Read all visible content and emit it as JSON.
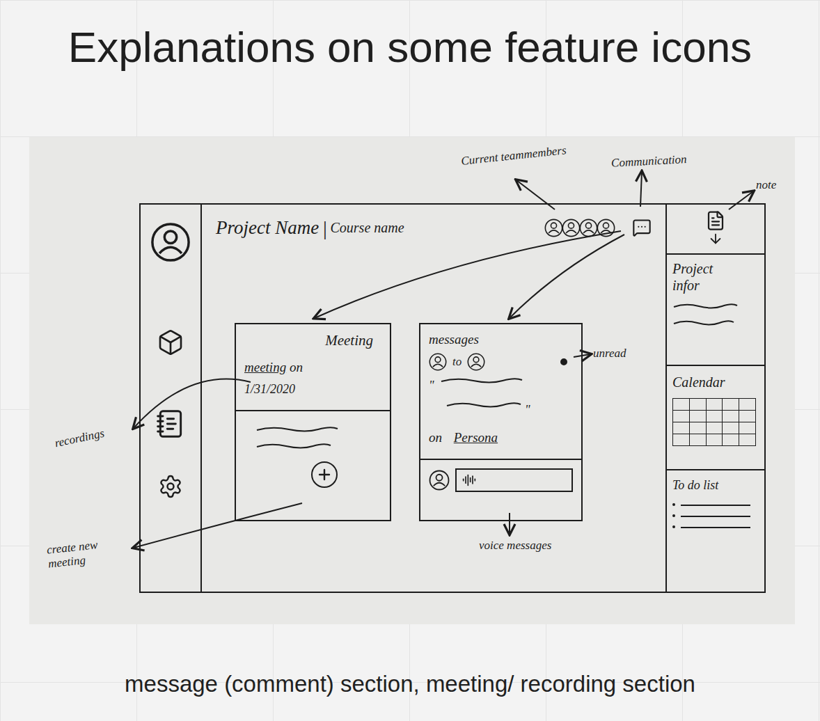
{
  "slide": {
    "title": "Explanations on some feature icons",
    "caption": "message (comment) section, meeting/ recording section"
  },
  "header": {
    "project": "Project Name",
    "separator": "|",
    "course": "Course name",
    "teammembers": [
      {
        "kind": "avatar"
      },
      {
        "kind": "avatar"
      },
      {
        "kind": "avatar"
      },
      {
        "kind": "avatar"
      }
    ]
  },
  "meeting_card": {
    "title": "Meeting",
    "link": "meeting",
    "suffix": "on",
    "date": "1/31/2020"
  },
  "messages_card": {
    "title": "messages",
    "to": "to",
    "quote_open": "\"",
    "quote_close": "\"",
    "on": "on",
    "link": "Persona",
    "unread": true
  },
  "right_panel": {
    "project_info": "Project infor",
    "calendar": "Calendar",
    "todo": {
      "title": "To do list",
      "items": [
        {
          "kind": "line"
        },
        {
          "kind": "line"
        },
        {
          "kind": "line"
        }
      ]
    }
  },
  "annotations": {
    "teammembers": "Current teammembers",
    "communication": "Communication",
    "note": "note",
    "unread": "unread",
    "voice": "voice messages",
    "recordings": "recordings",
    "create": "create new meeting"
  }
}
